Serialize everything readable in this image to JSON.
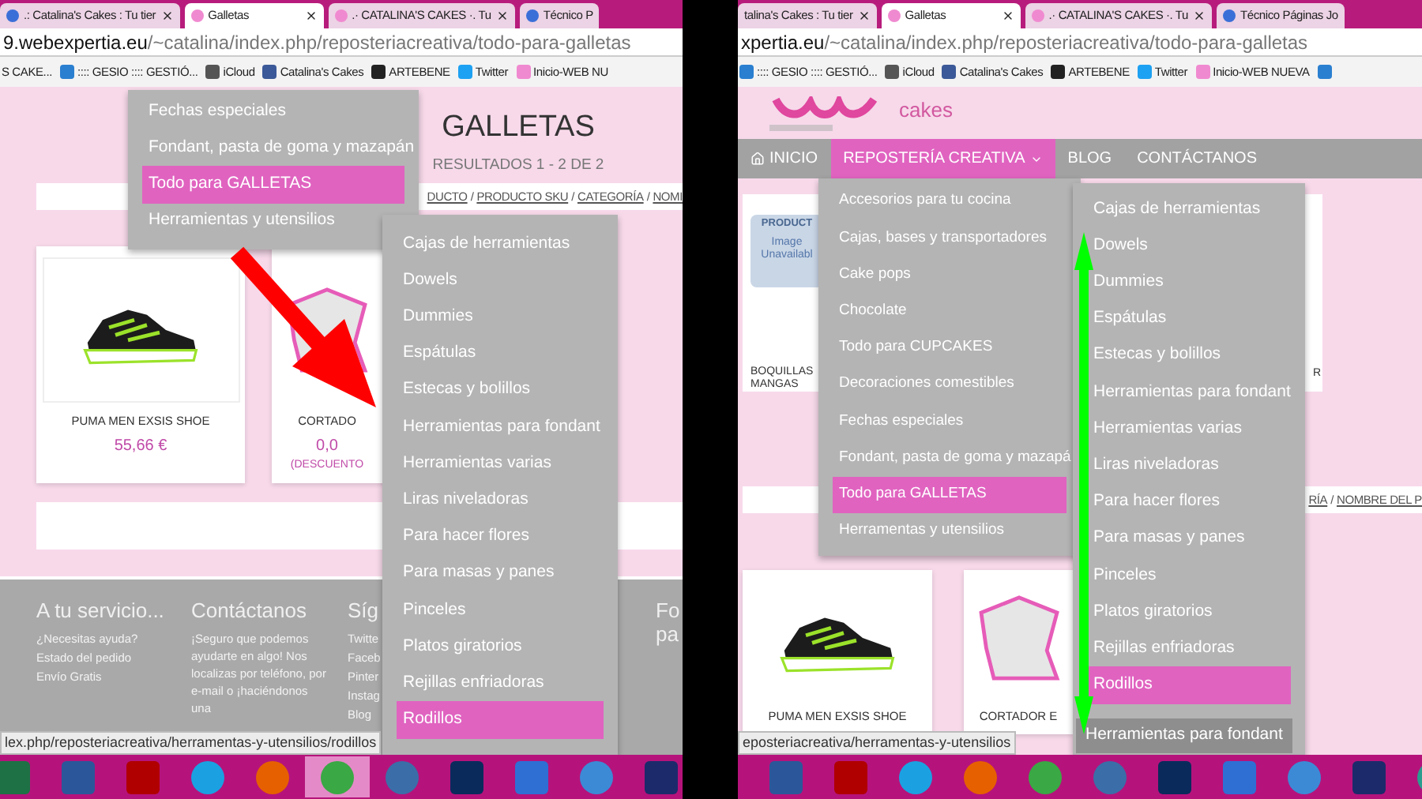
{
  "panels": [
    {
      "tabs": [
        {
          "label": ".: Catalina's Cakes : Tu tier",
          "selected": false,
          "closable": true,
          "color": "#3b6fd8"
        },
        {
          "label": "Galletas",
          "selected": true,
          "closable": true,
          "color": "#f08ad0"
        },
        {
          "label": ".· CATALINA'S CAKES ·. Tu",
          "selected": false,
          "closable": true,
          "color": "#f08ad0"
        },
        {
          "label": "Técnico P",
          "selected": false,
          "closable": false,
          "color": "#3b6fd8"
        }
      ],
      "url_host": "9.webexpertia.eu",
      "url_path": "/~catalina/index.php/reposteriacreativa/todo-para-galletas",
      "bookmarks": [
        {
          "label": "S CAKE..."
        },
        {
          "label": ":::: GESIO :::: GESTIÓ...",
          "color": "#2a7fd0"
        },
        {
          "label": "iCloud",
          "color": "#555555"
        },
        {
          "label": "Catalina's Cakes",
          "color": "#3b5998"
        },
        {
          "label": "ARTEBENE",
          "color": "#222222"
        },
        {
          "label": "Twitter",
          "color": "#1da1f2"
        },
        {
          "label": "Inicio-WEB NU",
          "color": "#f08ad0"
        }
      ],
      "heading": "GALLETAS",
      "results": "RESULTADOS 1 - 2 DE 2",
      "sort_bar": [
        {
          "kind": "link",
          "text": "DUCTO"
        },
        {
          "kind": "sep",
          "text": "/"
        },
        {
          "kind": "link",
          "text": "PRODUCTO SKU"
        },
        {
          "kind": "sep",
          "text": "/"
        },
        {
          "kind": "link",
          "text": "CATEGORÍA"
        },
        {
          "kind": "sep",
          "text": "/"
        },
        {
          "kind": "link",
          "text": "NOMI"
        }
      ],
      "products": [
        {
          "kind": "shoe",
          "name": "PUMA MEN EXSIS SHOE",
          "price": "55,66 €"
        },
        {
          "kind": "cutter",
          "name": "CORTADO",
          "price": "0,0",
          "discount": "(DESCUENTO"
        }
      ],
      "footer": [
        {
          "heading": "A tu servicio...",
          "links": [
            "¿Necesitas ayuda?",
            "Estado del pedido",
            "Envío Gratis"
          ]
        },
        {
          "heading": "Contáctanos",
          "text": "¡Seguro que podemos ayudarte en algo! Nos localizas por teléfono, por e-mail o ¡haciéndonos una"
        },
        {
          "heading": "Síg",
          "links": [
            "Twitte",
            "Faceb",
            "Pinter",
            "Instag",
            "Blog"
          ]
        },
        {
          "heading": "Fo pa"
        }
      ],
      "menus": [
        {
          "items": [
            {
              "label": "Fechas especiales",
              "selected": false
            },
            {
              "label": "Fondant, pasta de goma y mazapán",
              "selected": false
            },
            {
              "label": "Todo para GALLETAS",
              "selected": true
            },
            {
              "label": "Herramientas y utensilios",
              "selected": false
            }
          ]
        },
        {
          "items": [
            {
              "label": "Cajas de herramientas",
              "selected": false
            },
            {
              "label": "Dowels",
              "selected": false
            },
            {
              "label": "Dummies",
              "selected": false
            },
            {
              "label": "Espátulas",
              "selected": false
            },
            {
              "label": "Estecas y bolillos",
              "selected": false
            },
            {
              "label": "Herramientas para fondant",
              "selected": false
            },
            {
              "label": "Herramientas varias",
              "selected": false
            },
            {
              "label": "Liras niveladoras",
              "selected": false
            },
            {
              "label": "Para hacer flores",
              "selected": false
            },
            {
              "label": "Para masas y panes",
              "selected": false
            },
            {
              "label": "Pinceles",
              "selected": false
            },
            {
              "label": "Platos giratorios",
              "selected": false
            },
            {
              "label": "Rejillas enfriadoras",
              "selected": false
            },
            {
              "label": "Rodillos",
              "selected": true
            }
          ]
        }
      ],
      "arrow": {
        "kind": "single",
        "color": "#ff0000"
      },
      "status_url": "lex.php/reposteriacreativa/herramentas-y-utensilios/rodillos",
      "taskbar": [
        {
          "kind": "square",
          "color": "#1e7145",
          "active": false
        },
        {
          "kind": "square",
          "color": "#2b579a",
          "active": false
        },
        {
          "kind": "square",
          "color": "#b00000",
          "active": false
        },
        {
          "kind": "round",
          "color": "#1ba1e2",
          "active": false
        },
        {
          "kind": "round",
          "color": "#e66000",
          "active": false
        },
        {
          "kind": "round",
          "color": "#3aa845",
          "active": true
        },
        {
          "kind": "round",
          "color": "#3b6ea8",
          "active": false
        },
        {
          "kind": "square",
          "color": "#0a2a5c",
          "active": false
        },
        {
          "kind": "square",
          "color": "#2f6fd4",
          "active": false
        },
        {
          "kind": "round",
          "color": "#3c8ad6",
          "active": false
        },
        {
          "kind": "square",
          "color": "#1c2a6b",
          "active": false
        }
      ]
    },
    {
      "tabs": [
        {
          "label": "talina's Cakes : Tu tier",
          "selected": false,
          "closable": true
        },
        {
          "label": "Galletas",
          "selected": true,
          "closable": true,
          "color": "#f08ad0"
        },
        {
          "label": ".· CATALINA'S CAKES ·. Tu",
          "selected": false,
          "closable": true,
          "color": "#f08ad0"
        },
        {
          "label": "Técnico Páginas Jo",
          "selected": false,
          "closable": false,
          "color": "#3b6fd8"
        }
      ],
      "url_host": "xpertia.eu",
      "url_path": "/~catalina/index.php/reposteriacreativa/todo-para-galletas",
      "bookmarks": [
        {
          "label": ":::: GESIO :::: GESTIÓ...",
          "color": "#2a7fd0"
        },
        {
          "label": "iCloud",
          "color": "#555555"
        },
        {
          "label": "Catalina's Cakes",
          "color": "#3b5998"
        },
        {
          "label": "ARTEBENE",
          "color": "#222222"
        },
        {
          "label": "Twitter",
          "color": "#1da1f2"
        },
        {
          "label": "Inicio-WEB NUEVA",
          "color": "#f08ad0"
        },
        {
          "color": "#2a7fd0"
        }
      ],
      "logo_text": "cakes",
      "nav": [
        {
          "label": "INICIO",
          "kind": "home",
          "selected": false
        },
        {
          "label": "REPOSTERÍA CREATIVA",
          "kind": "dropdown",
          "selected": true
        },
        {
          "label": "BLOG",
          "kind": "plain",
          "selected": false
        },
        {
          "label": "CONTÁCTANOS",
          "kind": "plain",
          "selected": false
        }
      ],
      "products_top": [
        {
          "kind": "unavailable",
          "image_label": "PRODUCT",
          "image_text": "Image Unavailabl",
          "name": "BOQUILLAS MANGAS"
        },
        {
          "name": "R"
        }
      ],
      "sort_bar": [
        {
          "kind": "link",
          "text": "RÍA"
        },
        {
          "kind": "sep",
          "text": "/"
        },
        {
          "kind": "link",
          "text": "NOMBRE DEL P"
        }
      ],
      "products": [
        {
          "kind": "shoe",
          "name": "PUMA MEN EXSIS SHOE"
        },
        {
          "kind": "cutter",
          "name": "CORTADOR E"
        }
      ],
      "menus": [
        {
          "items": [
            {
              "label": "Accesorios para tu cocina",
              "selected": false
            },
            {
              "label": "Cajas, bases y transportadores",
              "selected": false
            },
            {
              "label": "Cake pops",
              "selected": false
            },
            {
              "label": "Chocolate",
              "selected": false
            },
            {
              "label": "Todo para CUPCAKES",
              "selected": false
            },
            {
              "label": "Decoraciones comestibles",
              "selected": false
            },
            {
              "label": "Fechas especiales",
              "selected": false
            },
            {
              "label": "Fondant, pasta de goma y mazapá",
              "selected": false
            },
            {
              "label": "Todo para GALLETAS",
              "selected": true
            },
            {
              "label": "Herramentas y utensilios",
              "selected": false
            }
          ]
        },
        {
          "items": [
            {
              "label": "Cajas de herramientas",
              "selected": false
            },
            {
              "label": "Dowels",
              "selected": false
            },
            {
              "label": "Dummies",
              "selected": false
            },
            {
              "label": "Espátulas",
              "selected": false
            },
            {
              "label": "Estecas y bolillos",
              "selected": false
            },
            {
              "label": "Herramientas para fondant",
              "selected": false
            },
            {
              "label": "Herramientas varias",
              "selected": false
            },
            {
              "label": "Liras niveladoras",
              "selected": false
            },
            {
              "label": "Para hacer flores",
              "selected": false
            },
            {
              "label": "Para masas y panes",
              "selected": false
            },
            {
              "label": "Pinceles",
              "selected": false
            },
            {
              "label": "Platos giratorios",
              "selected": false
            },
            {
              "label": "Rejillas enfriadoras",
              "selected": false
            },
            {
              "label": "Rodillos",
              "selected": true
            }
          ]
        }
      ],
      "tooltip": "Herramientas para fondant",
      "arrow": {
        "kind": "double",
        "color": "#00ff00"
      },
      "status_url": "eposteriacreativa/herramentas-y-utensilios",
      "taskbar": [
        {
          "kind": "square",
          "color": "#2b579a",
          "active": false
        },
        {
          "kind": "square",
          "color": "#b00000",
          "active": false
        },
        {
          "kind": "round",
          "color": "#1ba1e2",
          "active": false
        },
        {
          "kind": "round",
          "color": "#e66000",
          "active": false
        },
        {
          "kind": "round",
          "color": "#3aa845",
          "active": false
        },
        {
          "kind": "round",
          "color": "#3b6ea8",
          "active": false
        },
        {
          "kind": "square",
          "color": "#0a2a5c",
          "active": false
        },
        {
          "kind": "square",
          "color": "#2f6fd4",
          "active": false
        },
        {
          "kind": "round",
          "color": "#3c8ad6",
          "active": false
        },
        {
          "kind": "square",
          "color": "#1c2a6b",
          "active": false
        },
        {
          "kind": "round",
          "color": "#2a9d8f",
          "active": false
        }
      ]
    }
  ]
}
